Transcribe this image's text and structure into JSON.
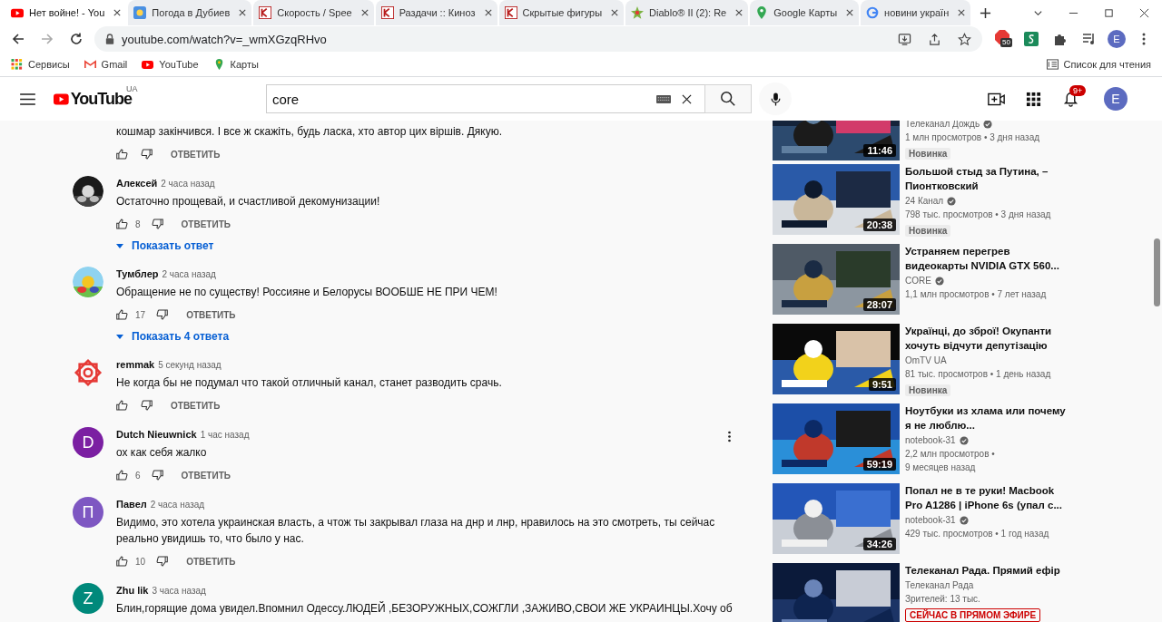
{
  "browser": {
    "tabs": [
      {
        "title": "Нет войне! - You",
        "kind": "youtube",
        "selected": true
      },
      {
        "title": "Погода в Дубиев",
        "kind": "weather",
        "selected": false
      },
      {
        "title": "Скорость / Spee",
        "kind": "letter-k",
        "selected": false
      },
      {
        "title": "Раздачи :: Кинoз",
        "kind": "letter-k",
        "selected": false
      },
      {
        "title": "Скрытые фигуры",
        "kind": "letter-k",
        "selected": false
      },
      {
        "title": "Diablo® II (2): Re",
        "kind": "star",
        "selected": false
      },
      {
        "title": "Google Карты",
        "kind": "maps",
        "selected": false
      },
      {
        "title": "новини україн",
        "kind": "google",
        "selected": false
      }
    ],
    "address": "youtube.com/watch?v=_wmXGzqRHvo",
    "extension_badge": "50",
    "profile_initial": "E",
    "bookmarks": [
      {
        "label": "Сервисы",
        "kind": "apps"
      },
      {
        "label": "Gmail",
        "kind": "gmail"
      },
      {
        "label": "YouTube",
        "kind": "youtube"
      },
      {
        "label": "Карты",
        "kind": "maps"
      }
    ],
    "reading_list": "Список для чтения"
  },
  "header": {
    "logo": "YouTube",
    "country": "UA",
    "search": {
      "value": "core"
    },
    "notifications": "9+",
    "avatar": "E"
  },
  "comments": [
    {
      "text": "кошмар закінчився. І все ж скажіть, будь ласка, хто автор цих віршів. Дякую.",
      "reply": "ОТВЕТИТЬ",
      "menu": false
    },
    {
      "author": "Алексей",
      "time": "2 часа назад",
      "text": "Остаточно прощевай, и счастливой  декомунизации!",
      "avatar": {
        "kind": "picture"
      },
      "likes": "8",
      "reply": "ОТВЕТИТЬ",
      "replies": "Показать ответ",
      "menu": false
    },
    {
      "author": "Тумблер",
      "time": "2 часа назад",
      "text": "Обращение не по существу! Россияне и Белорусы ВООБШЕ НЕ ПРИ ЧЕМ!",
      "avatar": {
        "kind": "picture"
      },
      "likes": "17",
      "reply": "ОТВЕТИТЬ",
      "replies": "Показать 4 ответа",
      "menu": false
    },
    {
      "author": "remmak",
      "time": "5 секунд назад",
      "text": "Не когда бы не подумал что такой отличный канал, станет разводить срачь.",
      "avatar": {
        "kind": "emblem"
      },
      "reply": "ОТВЕТИТЬ",
      "menu": false
    },
    {
      "author": "Dutch Nieuwnick",
      "time": "1 час назад",
      "text": "ох как себя жалко",
      "avatar": {
        "kind": "letter",
        "letter": "D",
        "color": "#7b1fa2"
      },
      "likes": "6",
      "reply": "ОТВЕТИТЬ",
      "menu": true
    },
    {
      "author": "Павел",
      "time": "2 часа назад",
      "text": "Видимо, это хотела украинская власть, а чтож ты закрывал глаза на днр и лнр, нравилось на это смотреть, ты сейчас реально увидишь то, что было у нас.",
      "avatar": {
        "kind": "letter",
        "letter": "П",
        "color": "#7e57c2"
      },
      "likes": "10",
      "reply": "ОТВЕТИТЬ",
      "menu": false
    },
    {
      "author": "Zhu lik",
      "time": "3 часа назад",
      "text": "Блин,горящие дома увидел.Впомнил Одессу.ЛЮДЕЙ ,БЕЗОРУЖНЫХ,СОЖГЛИ ,ЗАЖИВО,СВОИ ЖЕ УКРАИНЦЫ.Хочу об",
      "avatar": {
        "kind": "letter",
        "letter": "Z",
        "color": "#00897b"
      },
      "menu": false
    }
  ],
  "related": [
    {
      "channel": "Телеканал Дождь",
      "verified": true,
      "meta": [
        "1 млн просмотров • 3 дня назад"
      ],
      "duration": "11:46",
      "badge": {
        "kind": "new",
        "text": "Новинка"
      },
      "thumbnail": {
        "kind": "picture"
      }
    },
    {
      "title": "Большой стыд за Путина, – Пионтковский",
      "channel": "24 Канал",
      "verified": true,
      "meta": [
        "798 тыс. просмотров • 3 дня назад"
      ],
      "duration": "20:38",
      "badge": {
        "kind": "new",
        "text": "Новинка"
      },
      "thumbnail": {
        "kind": "picture"
      }
    },
    {
      "title": "Устраняем перегрев видеокарты NVIDIA GTX 560...",
      "channel": "CORE",
      "verified": true,
      "meta": [
        "1,1 млн просмотров • 7 лет назад"
      ],
      "duration": "28:07",
      "thumbnail": {
        "kind": "picture"
      }
    },
    {
      "title": "Українці, до зброї! Окупанти хочуть відчути депутізацію",
      "channel": "OmTV UA",
      "verified": false,
      "meta": [
        "81 тыс. просмотров • 1 день назад"
      ],
      "duration": "9:51",
      "badge": {
        "kind": "new",
        "text": "Новинка"
      },
      "thumbnail": {
        "kind": "picture"
      }
    },
    {
      "title": "Ноутбуки из хлама или почему я не люблю...",
      "channel": "notebook-31",
      "verified": true,
      "meta": [
        "2,2 млн просмотров •",
        "9 месяцев назад"
      ],
      "duration": "59:19",
      "thumbnail": {
        "kind": "picture"
      }
    },
    {
      "title": "Попал не в те руки! Macbook Pro A1286 | iPhone 6s (упал с...",
      "channel": "notebook-31",
      "verified": true,
      "meta": [
        "429 тыс. просмотров • 1 год назад"
      ],
      "duration": "34:26",
      "thumbnail": {
        "kind": "picture"
      }
    },
    {
      "title": "Телеканал Рада. Прямий ефір",
      "channel": "Телеканал Рада",
      "verified": false,
      "meta": [
        "Зрителей: 13 тыс."
      ],
      "badge": {
        "kind": "live",
        "text": "СЕЙЧАС В ПРЯМОМ ЭФИРЕ"
      },
      "thumbnail": {
        "kind": "picture"
      }
    }
  ]
}
